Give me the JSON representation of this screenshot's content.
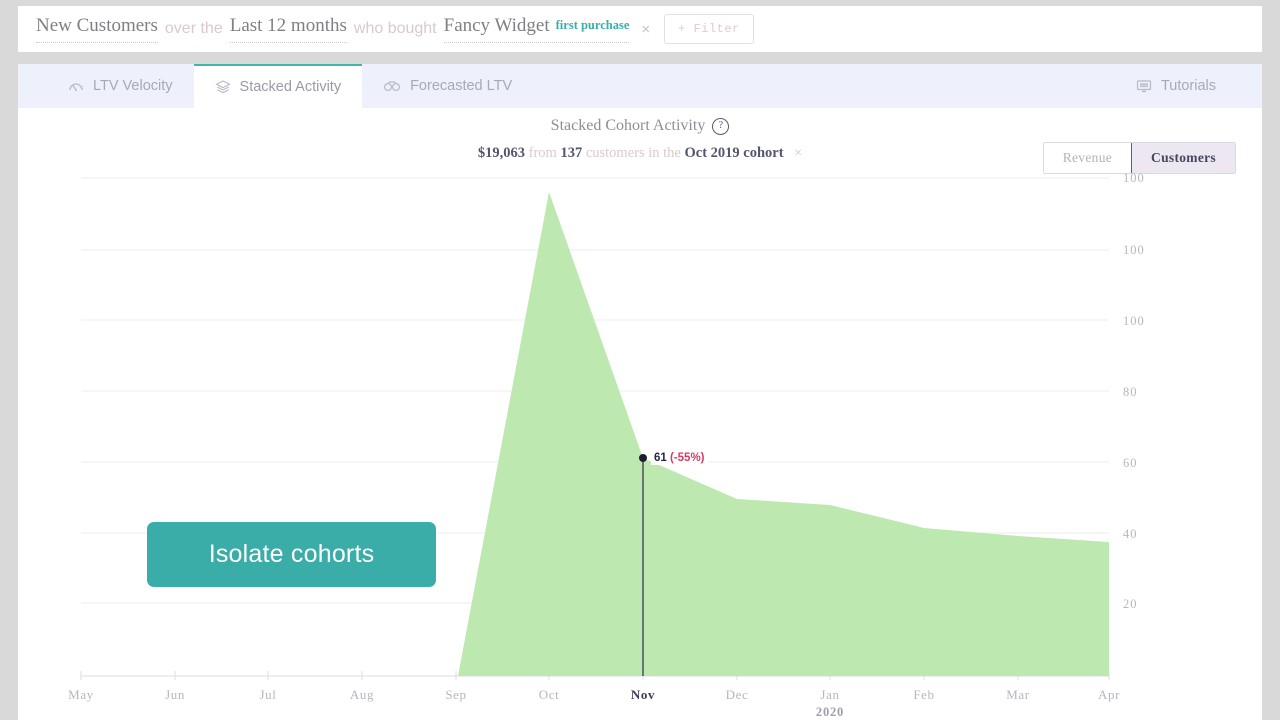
{
  "query_bar": {
    "segment": "New Customers",
    "conn1": "over the",
    "timeframe": "Last 12 months",
    "conn2": "who bought",
    "product": "Fancy Widget",
    "product_badge": "first purchase",
    "remove_label": "×",
    "filter_label": "+ Filter"
  },
  "tabs": {
    "items": [
      {
        "label": "LTV Velocity",
        "icon": "gauge-icon",
        "active": false
      },
      {
        "label": "Stacked Activity",
        "icon": "layers-icon",
        "active": true
      },
      {
        "label": "Forecasted LTV",
        "icon": "binoculars-icon",
        "active": false
      }
    ],
    "tutorials_label": "Tutorials",
    "tutorials_icon": "monitor-icon"
  },
  "chart_header": {
    "title": "Stacked Cohort Activity",
    "help_glyph": "?",
    "sub_amount": "$19,063",
    "sub_from": "from",
    "sub_count": "137",
    "sub_mid": "customers in the",
    "sub_cohort": "Oct 2019 cohort",
    "sub_remove": "×"
  },
  "metric_toggle": {
    "options": [
      "Revenue",
      "Customers"
    ],
    "selected": "Customers"
  },
  "callout": {
    "text": "Isolate cohorts",
    "color": "#3aada8"
  },
  "colors": {
    "area_fill": "#bde8b0",
    "accent_teal": "#3aada8",
    "highlight_red": "#d63b64",
    "panel_bg": "#ffffff",
    "tabstrip_bg": "#eef1fb",
    "page_bg": "#d9d9d9"
  },
  "chart_data": {
    "type": "area",
    "title": "Stacked Cohort Activity",
    "subtitle": "$19,063 from 137 customers in the Oct 2019 cohort",
    "xlabel": "",
    "ylabel": "",
    "grid": true,
    "legend": null,
    "x": [
      "May",
      "Jun",
      "Jul",
      "Aug",
      "Sep",
      "Oct",
      "Nov",
      "Dec",
      "Jan",
      "Feb",
      "Mar",
      "Apr"
    ],
    "x_year_annotation": {
      "label": "2020",
      "at": "Jan"
    },
    "x_highlight": "Nov",
    "ytick_labels": [
      "100",
      "100",
      "100",
      "80",
      "60",
      "40",
      "20"
    ],
    "ytick_values": [
      140,
      120,
      100,
      80,
      60,
      40,
      20
    ],
    "ylim": [
      0,
      145
    ],
    "series": [
      {
        "name": "Customers",
        "values": [
          0,
          0,
          0,
          0,
          0,
          137,
          61,
          54,
          52,
          48,
          45,
          43
        ],
        "fill": "#bde8b0"
      }
    ],
    "annotations": [
      {
        "x": "Nov",
        "y": 61,
        "value_label": "61",
        "change_label": "(-55%)",
        "marker": "dot",
        "rule": "vertical"
      }
    ]
  }
}
